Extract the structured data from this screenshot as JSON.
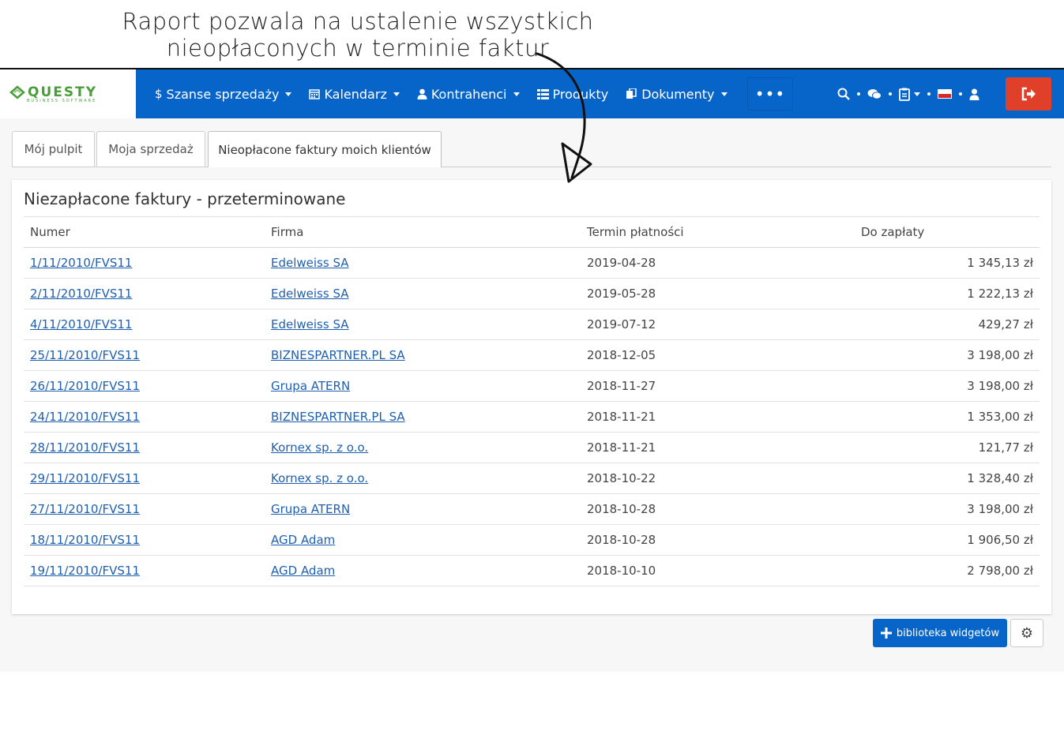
{
  "annotation": {
    "line1": "Raport pozwala na ustalenie wszystkich",
    "line2": "nieopłaconych w terminie faktur"
  },
  "brand": {
    "name": "QUESTY",
    "tagline": "BUSINESS SOFTWARE",
    "color": "#4a9e3a"
  },
  "colors": {
    "navbar": "#0765c9",
    "logout": "#e0402a",
    "link": "#1f5fb0"
  },
  "nav": {
    "items": [
      {
        "label": "Szanse sprzedaży",
        "icon": "dollar-icon"
      },
      {
        "label": "Kalendarz",
        "icon": "calendar-icon"
      },
      {
        "label": "Kontrahenci",
        "icon": "user-icon"
      },
      {
        "label": "Produkty",
        "icon": "list-icon"
      },
      {
        "label": "Dokumenty",
        "icon": "documents-icon"
      }
    ],
    "more_label": "•••"
  },
  "tabs": [
    {
      "label": "Mój pulpit",
      "active": false
    },
    {
      "label": "Moja sprzedaż",
      "active": false
    },
    {
      "label": "Nieopłacone faktury moich klientów",
      "active": true
    }
  ],
  "widget": {
    "title": "Niezapłacone faktury - przeterminowane",
    "columns": [
      "Numer",
      "Firma",
      "Termin płatności",
      "Do zapłaty"
    ],
    "rows": [
      [
        "1/11/2010/FVS11",
        "Edelweiss SA",
        "2019-04-28",
        "1 345,13 zł"
      ],
      [
        "2/11/2010/FVS11",
        "Edelweiss SA",
        "2019-05-28",
        "1 222,13 zł"
      ],
      [
        "4/11/2010/FVS11",
        "Edelweiss SA",
        "2019-07-12",
        "429,27 zł"
      ],
      [
        "25/11/2010/FVS11",
        "BIZNESPARTNER.PL SA",
        "2018-12-05",
        "3 198,00 zł"
      ],
      [
        "26/11/2010/FVS11",
        "Grupa ATERN",
        "2018-11-27",
        "3 198,00 zł"
      ],
      [
        "24/11/2010/FVS11",
        "BIZNESPARTNER.PL SA",
        "2018-11-21",
        "1 353,00 zł"
      ],
      [
        "28/11/2010/FVS11",
        "Kornex sp. z o.o.",
        "2018-11-21",
        "121,77 zł"
      ],
      [
        "29/11/2010/FVS11",
        "Kornex sp. z o.o.",
        "2018-10-22",
        "1 328,40 zł"
      ],
      [
        "27/11/2010/FVS11",
        "Grupa ATERN",
        "2018-10-28",
        "3 198,00 zł"
      ],
      [
        "18/11/2010/FVS11",
        "AGD Adam",
        "2018-10-28",
        "1 906,50 zł"
      ],
      [
        "19/11/2010/FVS11",
        "AGD Adam",
        "2018-10-10",
        "2 798,00 zł"
      ]
    ]
  },
  "footer": {
    "widgets_button": "biblioteka widgetów"
  }
}
